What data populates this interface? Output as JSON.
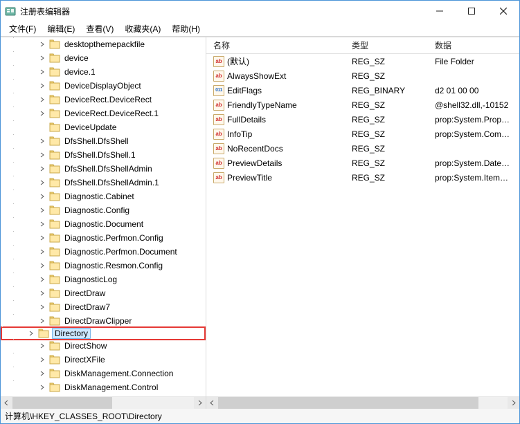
{
  "window": {
    "title": "注册表编辑器"
  },
  "menubar": {
    "items": [
      {
        "label": "文件(F)"
      },
      {
        "label": "编辑(E)"
      },
      {
        "label": "查看(V)"
      },
      {
        "label": "收藏夹(A)"
      },
      {
        "label": "帮助(H)"
      }
    ]
  },
  "tree": {
    "items": [
      {
        "label": "desktopthemepackfile"
      },
      {
        "label": "device"
      },
      {
        "label": "device.1"
      },
      {
        "label": "DeviceDisplayObject"
      },
      {
        "label": "DeviceRect.DeviceRect"
      },
      {
        "label": "DeviceRect.DeviceRect.1"
      },
      {
        "label": "DeviceUpdate",
        "no_chevron": true
      },
      {
        "label": "DfsShell.DfsShell"
      },
      {
        "label": "DfsShell.DfsShell.1"
      },
      {
        "label": "DfsShell.DfsShellAdmin"
      },
      {
        "label": "DfsShell.DfsShellAdmin.1"
      },
      {
        "label": "Diagnostic.Cabinet"
      },
      {
        "label": "Diagnostic.Config"
      },
      {
        "label": "Diagnostic.Document"
      },
      {
        "label": "Diagnostic.Perfmon.Config"
      },
      {
        "label": "Diagnostic.Perfmon.Document"
      },
      {
        "label": "Diagnostic.Resmon.Config"
      },
      {
        "label": "DiagnosticLog"
      },
      {
        "label": "DirectDraw"
      },
      {
        "label": "DirectDraw7"
      },
      {
        "label": "DirectDrawClipper"
      },
      {
        "label": "Directory",
        "selected": true,
        "highlighted": true
      },
      {
        "label": "DirectShow"
      },
      {
        "label": "DirectXFile"
      },
      {
        "label": "DiskManagement.Connection"
      },
      {
        "label": "DiskManagement.Control"
      }
    ]
  },
  "listview": {
    "headers": {
      "name": "名称",
      "type": "类型",
      "data": "数据"
    },
    "rows": [
      {
        "icon": "str",
        "name": "(默认)",
        "type": "REG_SZ",
        "data": "File Folder"
      },
      {
        "icon": "str",
        "name": "AlwaysShowExt",
        "type": "REG_SZ",
        "data": ""
      },
      {
        "icon": "bin",
        "name": "EditFlags",
        "type": "REG_BINARY",
        "data": "d2 01 00 00"
      },
      {
        "icon": "str",
        "name": "FriendlyTypeName",
        "type": "REG_SZ",
        "data": "@shell32.dll,-10152"
      },
      {
        "icon": "str",
        "name": "FullDetails",
        "type": "REG_SZ",
        "data": "prop:System.PropGroup"
      },
      {
        "icon": "str",
        "name": "InfoTip",
        "type": "REG_SZ",
        "data": "prop:System.Comment"
      },
      {
        "icon": "str",
        "name": "NoRecentDocs",
        "type": "REG_SZ",
        "data": ""
      },
      {
        "icon": "str",
        "name": "PreviewDetails",
        "type": "REG_SZ",
        "data": "prop:System.DateModified"
      },
      {
        "icon": "str",
        "name": "PreviewTitle",
        "type": "REG_SZ",
        "data": "prop:System.ItemName"
      }
    ]
  },
  "statusbar": {
    "path": "计算机\\HKEY_CLASSES_ROOT\\Directory"
  },
  "left_scroll_thumb_pct": 55,
  "right_scroll_thumb_pct": 90
}
